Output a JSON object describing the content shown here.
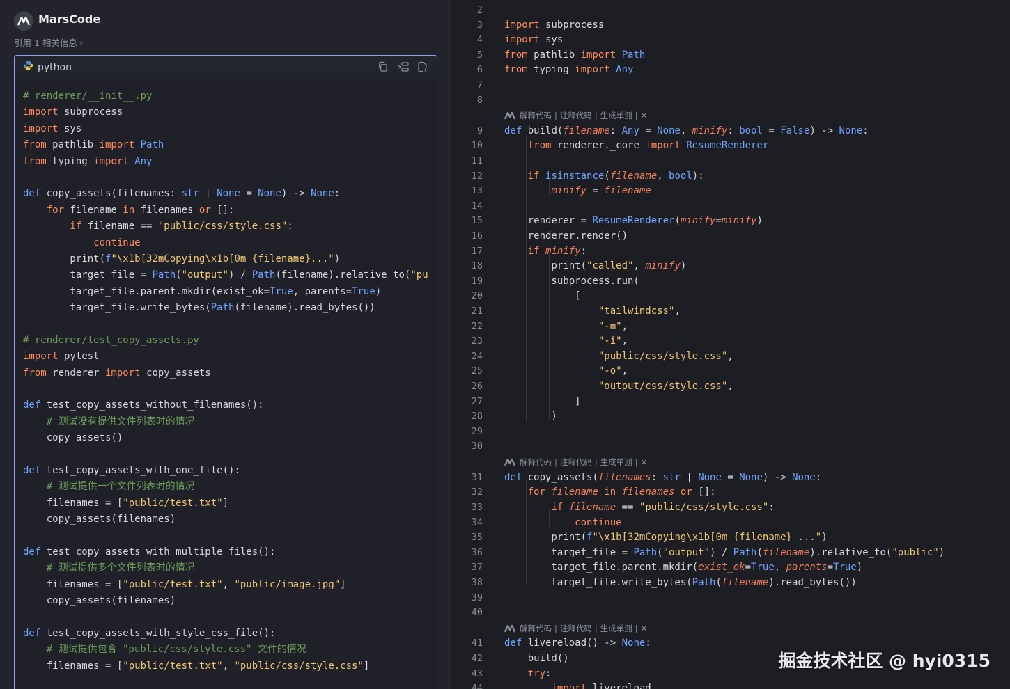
{
  "app": {
    "title": "MarsCode",
    "refs": "引用 1 相关信息"
  },
  "codeblock": {
    "language": "python",
    "tools": [
      "copy-icon",
      "insert-icon",
      "new-file-icon"
    ],
    "lines": [
      "# renderer/__init__.py",
      "import subprocess",
      "import sys",
      "from pathlib import Path",
      "from typing import Any",
      "",
      "def copy_assets(filenames: str | None = None) -> None:",
      "    for filename in filenames or []:",
      "        if filename == \"public/css/style.css\":",
      "            continue",
      "        print(f\"\\x1b[32mCopying\\x1b[0m {filename}...\")",
      "        target_file = Path(\"output\") / Path(filename).relative_to(\"pu",
      "        target_file.parent.mkdir(exist_ok=True, parents=True)",
      "        target_file.write_bytes(Path(filename).read_bytes())",
      "",
      "# renderer/test_copy_assets.py",
      "import pytest",
      "from renderer import copy_assets",
      "",
      "def test_copy_assets_without_filenames():",
      "    # 测试没有提供文件列表时的情况",
      "    copy_assets()",
      "",
      "def test_copy_assets_with_one_file():",
      "    # 测试提供一个文件列表时的情况",
      "    filenames = [\"public/test.txt\"]",
      "    copy_assets(filenames)",
      "",
      "def test_copy_assets_with_multiple_files():",
      "    # 测试提供多个文件列表时的情况",
      "    filenames = [\"public/test.txt\", \"public/image.jpg\"]",
      "    copy_assets(filenames)",
      "",
      "def test_copy_assets_with_style_css_file():",
      "    # 测试提供包含 \"public/css/style.css\" 文件的情况",
      "    filenames = [\"public/test.txt\", \"public/css/style.css\"]"
    ]
  },
  "codelens": {
    "explain": "解释代码",
    "comment": "注释代码",
    "unittest": "生成单测",
    "close": "✕"
  },
  "editor": {
    "lines": [
      {
        "n": "2",
        "code": ""
      },
      {
        "n": "3",
        "code": "import subprocess"
      },
      {
        "n": "4",
        "code": "import sys"
      },
      {
        "n": "5",
        "code": "from pathlib import Path"
      },
      {
        "n": "6",
        "code": "from typing import Any"
      },
      {
        "n": "7",
        "code": ""
      },
      {
        "n": "8",
        "code": ""
      },
      {
        "n": "9",
        "code": "def build(filename: Any = None, minify: bool = False) -> None:"
      },
      {
        "n": "10",
        "code": "    from renderer._core import ResumeRenderer"
      },
      {
        "n": "11",
        "code": ""
      },
      {
        "n": "12",
        "code": "    if isinstance(filename, bool):"
      },
      {
        "n": "13",
        "code": "        minify = filename"
      },
      {
        "n": "14",
        "code": ""
      },
      {
        "n": "15",
        "code": "    renderer = ResumeRenderer(minify=minify)"
      },
      {
        "n": "16",
        "code": "    renderer.render()"
      },
      {
        "n": "17",
        "code": "    if minify:"
      },
      {
        "n": "18",
        "code": "        print(\"called\", minify)"
      },
      {
        "n": "19",
        "code": "        subprocess.run("
      },
      {
        "n": "20",
        "code": "            ["
      },
      {
        "n": "21",
        "code": "                \"tailwindcss\","
      },
      {
        "n": "22",
        "code": "                \"-m\","
      },
      {
        "n": "23",
        "code": "                \"-i\","
      },
      {
        "n": "24",
        "code": "                \"public/css/style.css\","
      },
      {
        "n": "25",
        "code": "                \"-o\","
      },
      {
        "n": "26",
        "code": "                \"output/css/style.css\","
      },
      {
        "n": "27",
        "code": "            ]"
      },
      {
        "n": "28",
        "code": "        )"
      },
      {
        "n": "29",
        "code": ""
      },
      {
        "n": "30",
        "code": ""
      },
      {
        "n": "31",
        "code": "def copy_assets(filenames: str | None = None) -> None:"
      },
      {
        "n": "32",
        "code": "    for filename in filenames or []:"
      },
      {
        "n": "33",
        "code": "        if filename == \"public/css/style.css\":"
      },
      {
        "n": "34",
        "code": "            continue"
      },
      {
        "n": "35",
        "code": "        print(f\"\\x1b[32mCopying\\x1b[0m {filename} ...\")"
      },
      {
        "n": "36",
        "code": "        target_file = Path(\"output\") / Path(filename).relative_to(\"public\")"
      },
      {
        "n": "37",
        "code": "        target_file.parent.mkdir(exist_ok=True, parents=True)"
      },
      {
        "n": "38",
        "code": "        target_file.write_bytes(Path(filename).read_bytes())"
      },
      {
        "n": "39",
        "code": ""
      },
      {
        "n": "40",
        "code": ""
      },
      {
        "n": "41",
        "code": "def livereload() -> None:"
      },
      {
        "n": "42",
        "code": "    build()"
      },
      {
        "n": "43",
        "code": "    try:"
      },
      {
        "n": "44",
        "code": "        import livereload"
      }
    ]
  },
  "watermark": "掘金技术社区 @ hyi0315"
}
